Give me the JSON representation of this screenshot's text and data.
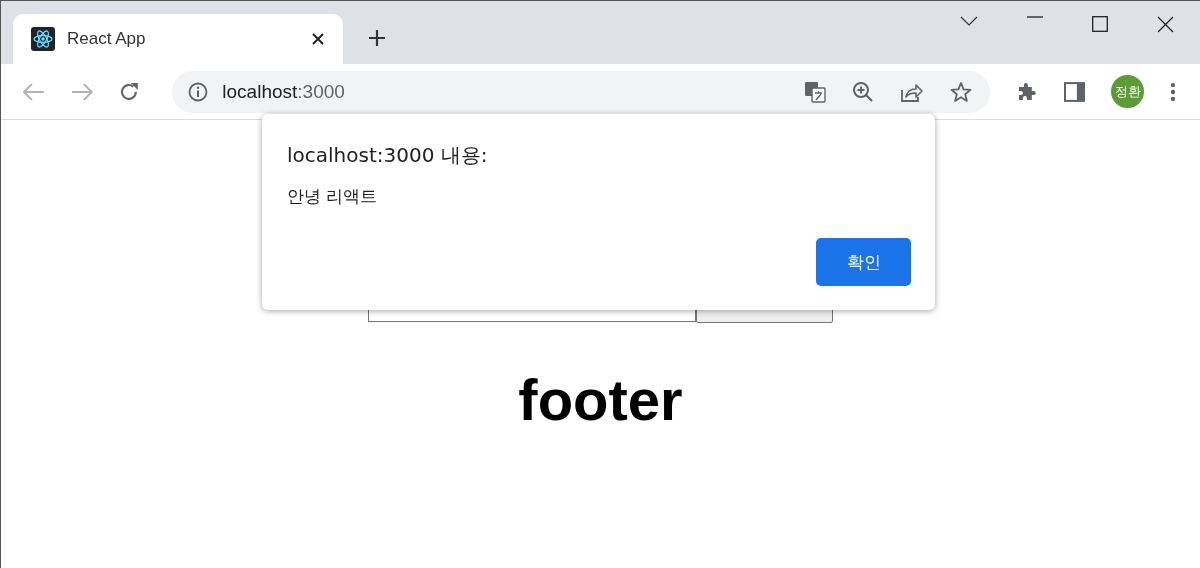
{
  "tab": {
    "title": "React App"
  },
  "address_bar": {
    "host": "localhost",
    "port": ":3000"
  },
  "profile": {
    "initials": "정환"
  },
  "page": {
    "heading": "footer"
  },
  "dialog": {
    "title": "localhost:3000 내용:",
    "message": "안녕 리액트",
    "button": "확인"
  }
}
